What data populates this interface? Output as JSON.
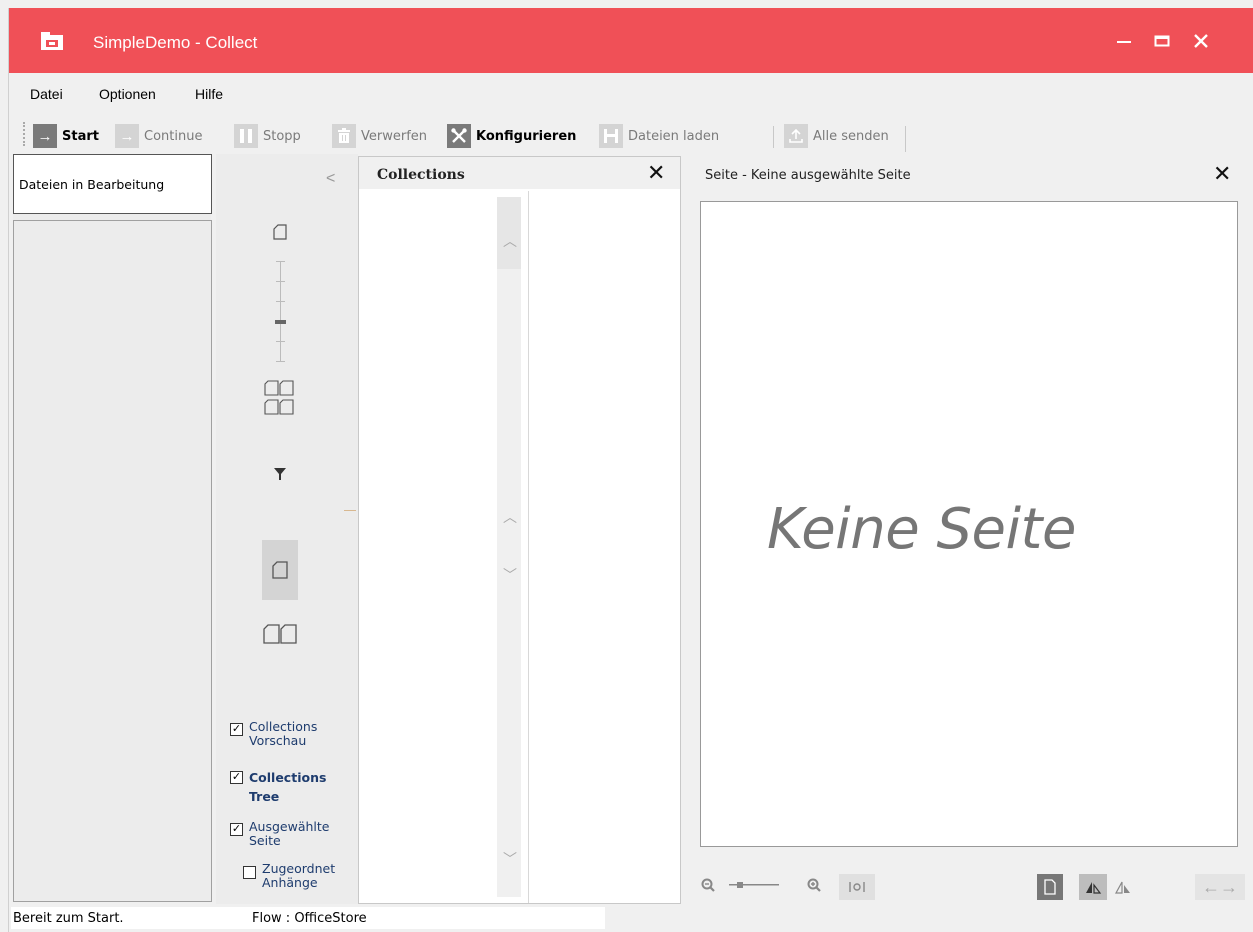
{
  "window": {
    "title": "SimpleDemo - Collect"
  },
  "colors": {
    "titlebar": "#f05057",
    "toolbar_icon_dark": "#7a7a7a",
    "toolbar_icon_light": "#d4d4d4"
  },
  "menu": {
    "items": [
      "Datei",
      "Optionen",
      "Hilfe"
    ]
  },
  "toolbar": {
    "start": "Start",
    "continue": "Continue",
    "stopp": "Stopp",
    "verwerfen": "Verwerfen",
    "konfigurieren": "Konfigurieren",
    "dateien_laden": "Dateien laden",
    "alle_senden": "Alle senden"
  },
  "left_panel": {
    "tab_label": "Dateien in Bearbeitung"
  },
  "side_strip": {
    "checkboxes": [
      {
        "label_line1": "Collections",
        "label_line2": "Vorschau",
        "checked": true,
        "bold": false
      },
      {
        "label_line1": "Collections",
        "label_line2": "Tree",
        "checked": true,
        "bold": true
      },
      {
        "label_line1": "Ausgewählte",
        "label_line2": "Seite",
        "checked": true,
        "bold": false
      },
      {
        "label_line1": "Zugeordnet",
        "label_line2": "Anhänge",
        "checked": false,
        "bold": false
      }
    ]
  },
  "collections_panel": {
    "title": "Collections"
  },
  "page_panel": {
    "title": "Seite - Keine ausgewählte Seite",
    "placeholder": "Keine Seite"
  },
  "status": {
    "left": "Bereit zum Start.",
    "flow": "Flow : OfficeStore"
  }
}
